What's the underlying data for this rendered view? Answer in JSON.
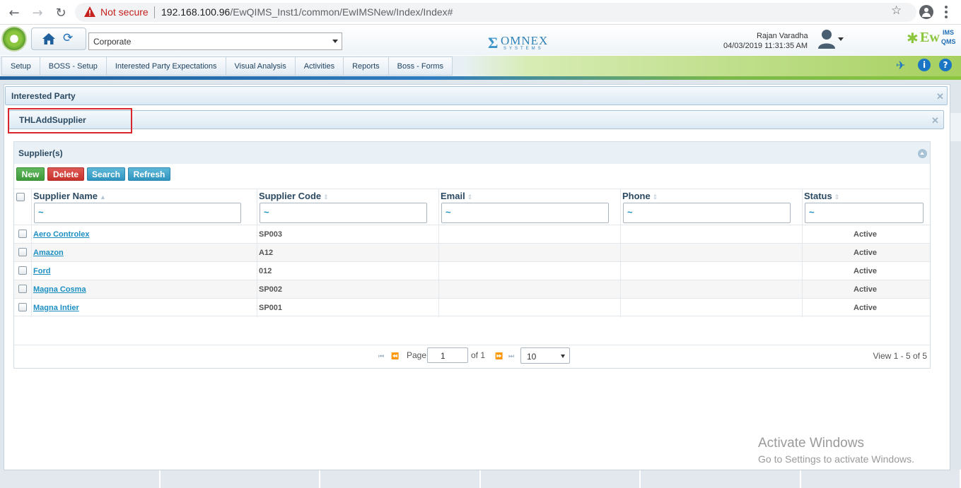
{
  "browser": {
    "not_secure": "Not secure",
    "url_host": "192.168.100.96",
    "url_path": "/EwQIMS_Inst1/common/EwIMSNew/Index/Index#"
  },
  "header": {
    "org_select": "Corporate",
    "omnex_name": "OMNEX",
    "omnex_sub": "SYSTEMS",
    "user_name": "Rajan Varadha",
    "user_time": "04/03/2019 11:31:35 AM",
    "brand": {
      "ew": "Ew",
      "ims": "IMS",
      "qms": "QMS"
    }
  },
  "nav": {
    "items": [
      "Setup",
      "BOSS - Setup",
      "Interested Party Expectations",
      "Visual Analysis",
      "Activities",
      "Reports",
      "Boss - Forms"
    ]
  },
  "panels": {
    "outer_title": "Interested Party",
    "inner_title": "THLAddSupplier"
  },
  "grid": {
    "caption": "Supplier(s)",
    "buttons": {
      "new": "New",
      "delete": "Delete",
      "search": "Search",
      "refresh": "Refresh"
    },
    "columns": [
      "Supplier Name",
      "Supplier Code",
      "Email",
      "Phone",
      "Status"
    ],
    "filter_placeholder": "~",
    "rows": [
      {
        "name": "Aero Controlex",
        "code": "SP003",
        "email": "",
        "phone": "",
        "status": "Active"
      },
      {
        "name": "Amazon",
        "code": "A12",
        "email": "",
        "phone": "",
        "status": "Active"
      },
      {
        "name": "Ford",
        "code": "012",
        "email": "",
        "phone": "",
        "status": "Active"
      },
      {
        "name": "Magna Cosma",
        "code": "SP002",
        "email": "",
        "phone": "",
        "status": "Active"
      },
      {
        "name": "Magna Intier",
        "code": "SP001",
        "email": "",
        "phone": "",
        "status": "Active"
      }
    ],
    "pager": {
      "page_label": "Page",
      "page_value": "1",
      "of_label": "of 1",
      "page_size": "10",
      "view_text": "View 1 - 5 of 5"
    }
  },
  "watermark": {
    "line1": "Activate Windows",
    "line2": "Go to Settings to activate Windows."
  },
  "colors": {
    "accent_blue": "#1a75c4",
    "link_blue": "#1c8fc2",
    "new_green": "#3e9a3a",
    "delete_red": "#c7322c",
    "highlight_red": "#d9262d"
  }
}
